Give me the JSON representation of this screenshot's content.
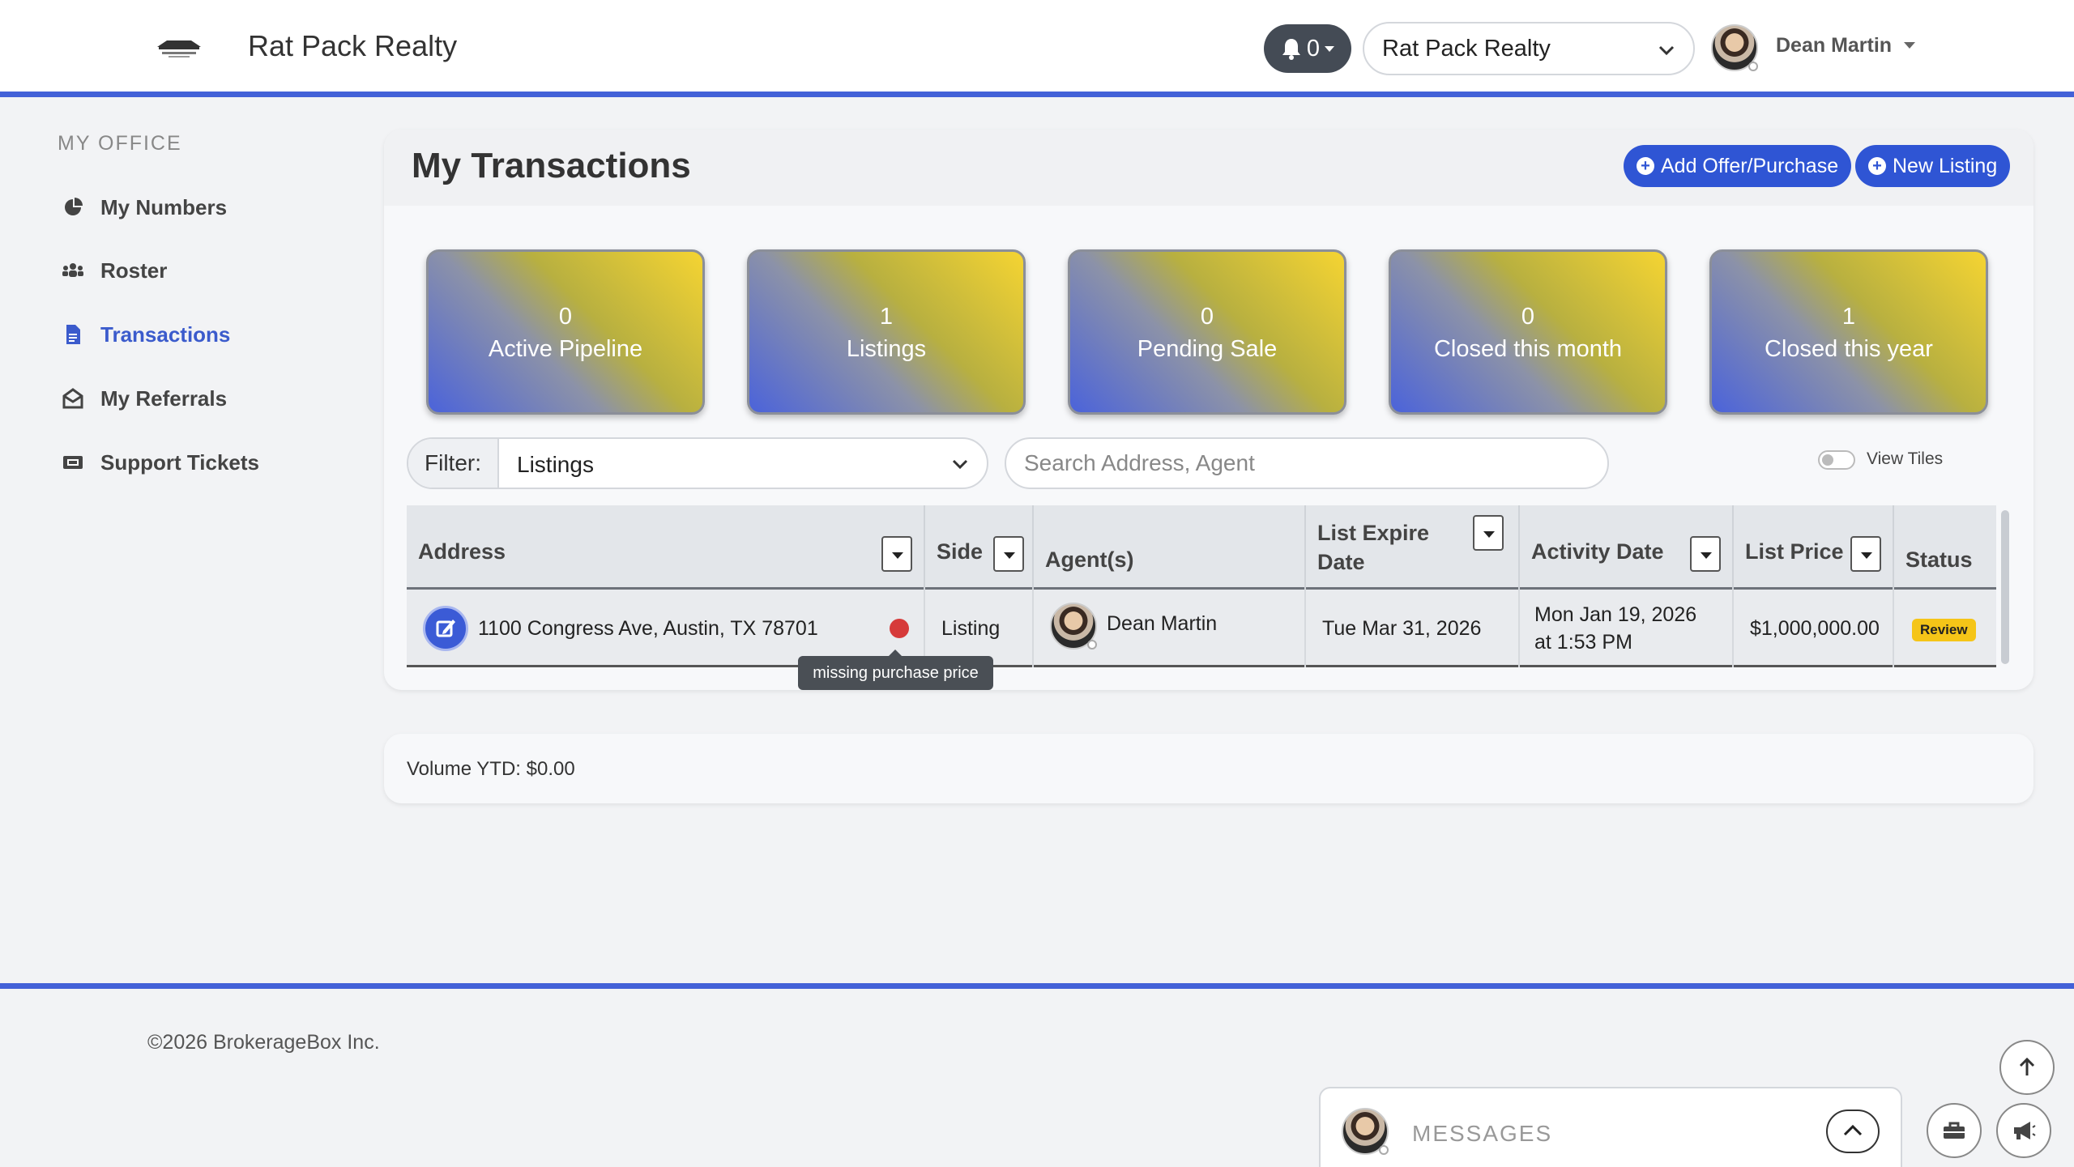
{
  "header": {
    "brand": "Rat Pack Realty",
    "logo_text": "RAT PACK REALTY",
    "notifications_count": "0",
    "company_select": "Rat Pack Realty",
    "user_name": "Dean Martin"
  },
  "sidebar": {
    "title": "MY OFFICE",
    "items": [
      {
        "label": "My Numbers",
        "icon": "pie-chart-icon"
      },
      {
        "label": "Roster",
        "icon": "users-icon"
      },
      {
        "label": "Transactions",
        "icon": "file-icon",
        "active": true
      },
      {
        "label": "My Referrals",
        "icon": "envelope-open-icon"
      },
      {
        "label": "Support Tickets",
        "icon": "ticket-icon"
      }
    ]
  },
  "main": {
    "title": "My Transactions",
    "add_offer_label": "Add Offer/Purchase",
    "new_listing_label": "New Listing",
    "tiles": [
      {
        "value": "0",
        "label": "Active Pipeline"
      },
      {
        "value": "1",
        "label": "Listings"
      },
      {
        "value": "0",
        "label": "Pending Sale"
      },
      {
        "value": "0",
        "label": "Closed this month"
      },
      {
        "value": "1",
        "label": "Closed this year"
      }
    ],
    "filter_label": "Filter:",
    "filter_value": "Listings",
    "search_placeholder": "Search Address, Agent",
    "view_tiles_label": "View Tiles"
  },
  "table": {
    "columns": [
      "Address",
      "Side",
      "Agent(s)",
      "List Expire Date",
      "Activity Date",
      "List Price",
      "Status"
    ],
    "rows": [
      {
        "address": "1100 Congress Ave, Austin, TX 78701",
        "side": "Listing",
        "agent": "Dean Martin",
        "list_expire_date": "Tue Mar 31, 2026",
        "activity_date": "Mon Jan 19, 2026 at 1:53 PM",
        "list_price": "$1,000,000.00",
        "status": "Review"
      }
    ],
    "tooltip": "missing purchase price"
  },
  "volume": {
    "text": "Volume YTD: $0.00"
  },
  "footer": {
    "copyright": "©2026 BrokerageBox Inc.",
    "messages_label": "MESSAGES"
  },
  "colors": {
    "accent": "#4361d8",
    "button_blue": "#2f55d4",
    "status_review": "#f5c518",
    "alert_red": "#d63a3a"
  }
}
